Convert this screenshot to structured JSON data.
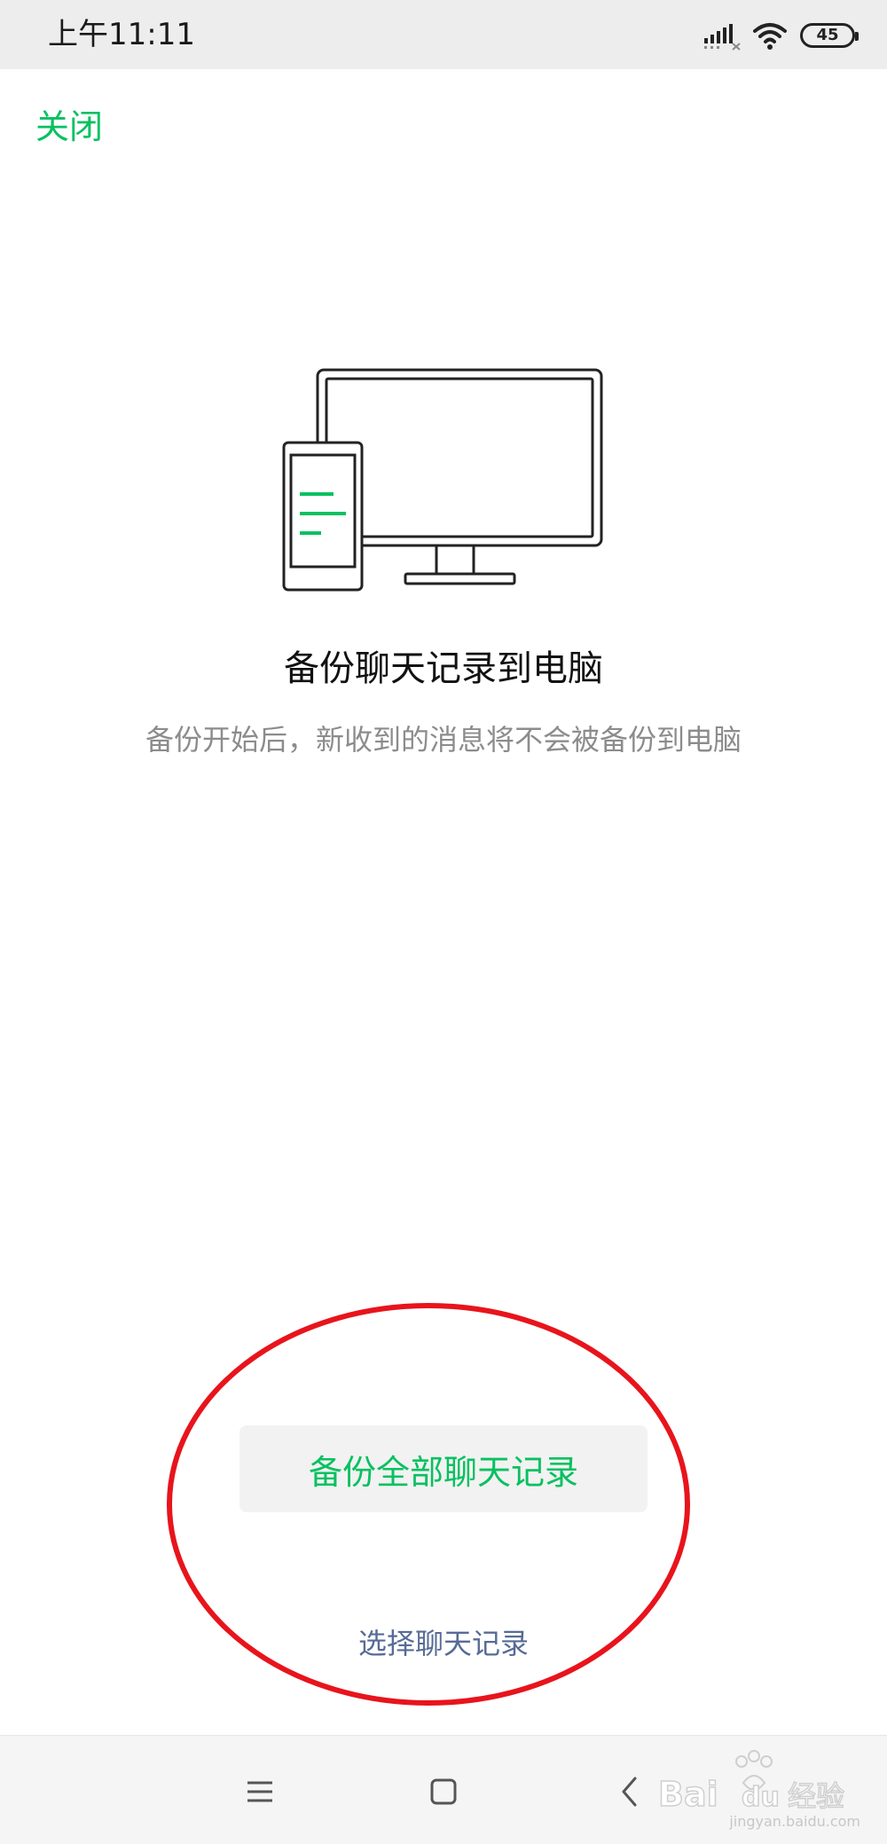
{
  "status_bar": {
    "time": "上午11:11",
    "battery_level": "45",
    "icons": [
      "signal-icon",
      "wifi-icon",
      "battery-icon"
    ]
  },
  "header": {
    "close_label": "关闭"
  },
  "illustration": {
    "icon": "phone-to-monitor-icon",
    "accent_color": "#07c160"
  },
  "main": {
    "title": "备份聊天记录到电脑",
    "subtitle": "备份开始后，新收到的消息将不会被备份到电脑"
  },
  "actions": {
    "backup_all_label": "备份全部聊天记录",
    "select_records_label": "选择聊天记录"
  },
  "annotation": {
    "shape": "ellipse",
    "color": "#e8141c"
  },
  "nav_bar": {
    "icons": [
      "menu-icon",
      "home-icon",
      "back-icon"
    ]
  },
  "watermark": {
    "brand": "Bai du 经验",
    "url": "jingyan.baidu.com"
  },
  "colors": {
    "brand_green": "#07c160",
    "link_blue": "#576b95",
    "subtitle_gray": "#8c8c8c"
  }
}
